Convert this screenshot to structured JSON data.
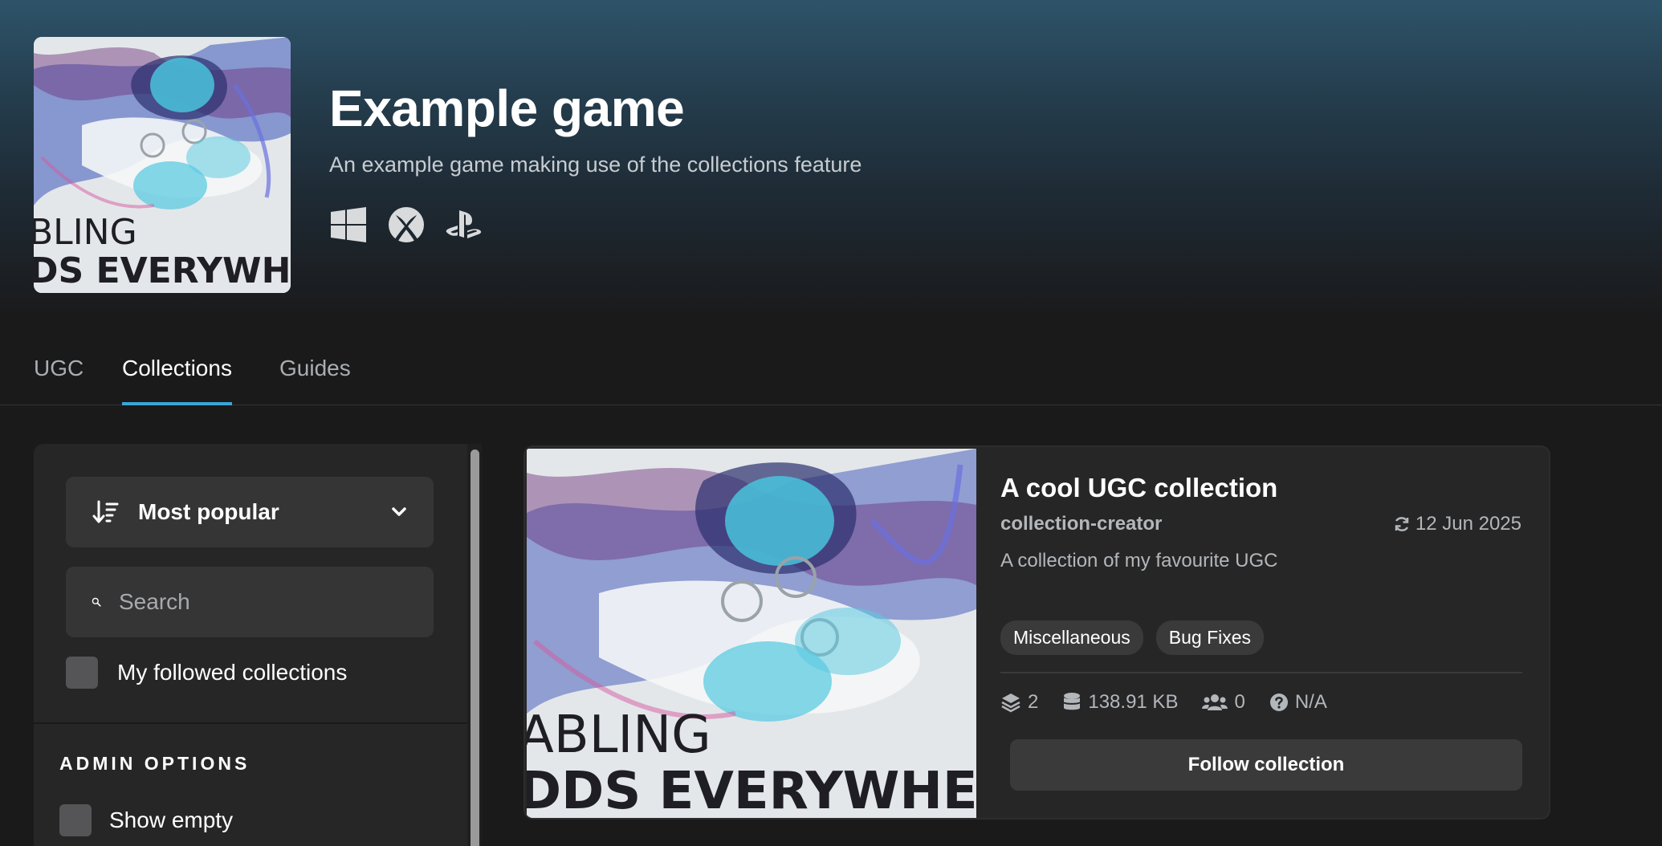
{
  "game": {
    "title": "Example game",
    "subtitle": "An example game making use of the collections feature",
    "cover_text_line1": "BLING",
    "cover_text_line2": "DS EVERYWHER",
    "platforms": [
      "windows-icon",
      "xbox-icon",
      "playstation-icon"
    ]
  },
  "tabs": [
    {
      "label": "UGC",
      "active": false
    },
    {
      "label": "Collections",
      "active": true
    },
    {
      "label": "Guides",
      "active": false
    }
  ],
  "sidebar": {
    "sort_label": "Most popular",
    "search_placeholder": "Search",
    "followed_label": "My followed collections",
    "admin_heading": "ADMIN OPTIONS",
    "show_empty_label": "Show empty"
  },
  "collection": {
    "title": "A cool UGC collection",
    "author": "collection-creator",
    "updated": "12 Jun 2025",
    "description": "A collection of my favourite UGC",
    "tags": [
      "Miscellaneous",
      "Bug Fixes"
    ],
    "image_text_line1": "ABLING",
    "image_text_line2": "DDS EVERYWHERE",
    "stats": {
      "mods": "2",
      "size": "138.91 KB",
      "followers": "0",
      "rating": "N/A"
    },
    "follow_label": "Follow collection"
  },
  "colors": {
    "accent": "#3aa6d8",
    "background": "#1a1a1b",
    "panel": "#262627"
  }
}
